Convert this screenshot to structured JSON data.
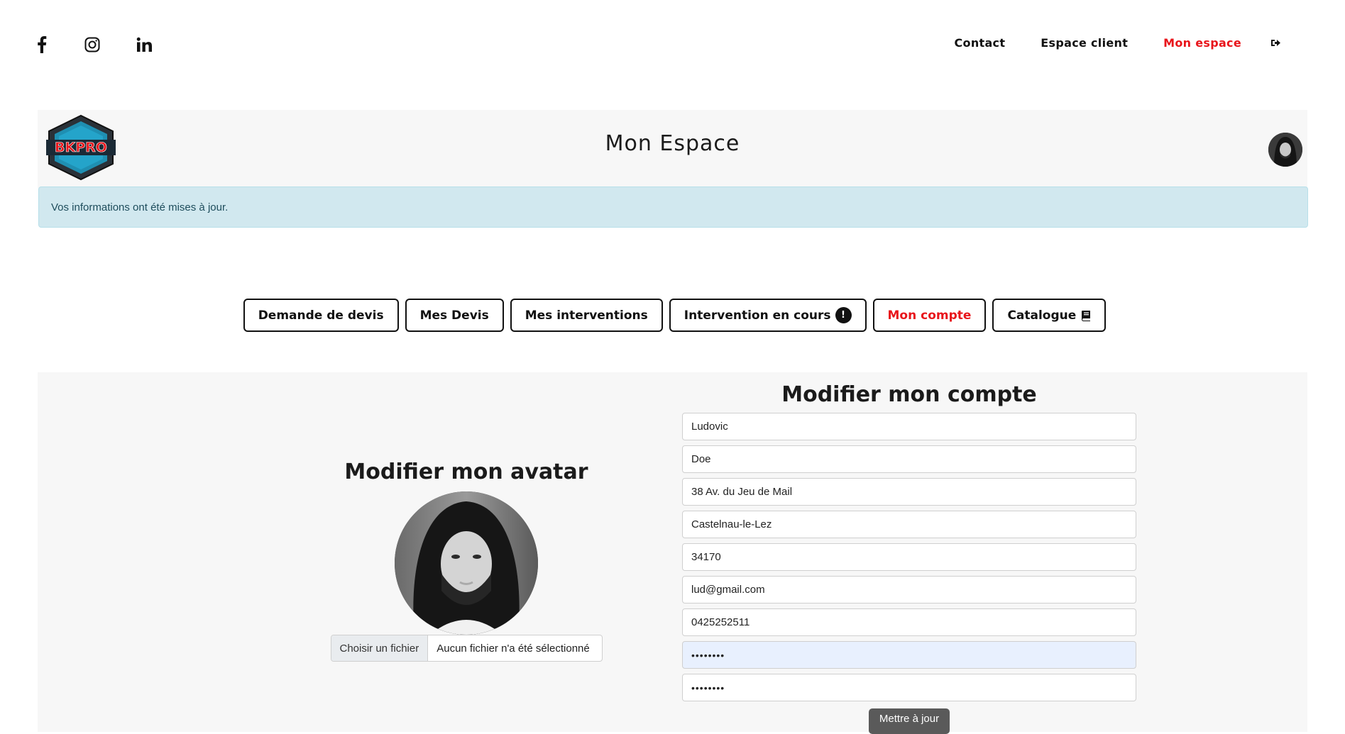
{
  "social": {
    "facebook_icon": "facebook-icon",
    "instagram_icon": "instagram-icon",
    "linkedin_icon": "linkedin-icon"
  },
  "nav": {
    "items": [
      {
        "label": "Contact",
        "active": false
      },
      {
        "label": "Espace client",
        "active": false
      },
      {
        "label": "Mon espace",
        "active": true
      }
    ],
    "logout_icon": "logout-icon",
    "active_color": "#e8151b"
  },
  "header": {
    "title": "Mon Espace",
    "logo_text": "BKPRO"
  },
  "alert": {
    "message": "Vos informations ont été mises à jour."
  },
  "tabs": [
    {
      "label": "Demande de devis"
    },
    {
      "label": "Mes Devis"
    },
    {
      "label": "Mes interventions"
    },
    {
      "label": "Intervention en cours",
      "badge": "!"
    },
    {
      "label": "Mon compte",
      "active": true
    },
    {
      "label": "Catalogue",
      "icon": "book-icon"
    }
  ],
  "avatar_section": {
    "title": "Modifier mon avatar",
    "file_button": "Choisir un fichier",
    "file_status": "Aucun fichier n'a été sélectionné"
  },
  "account_section": {
    "title": "Modifier mon compte",
    "fields": {
      "firstname": "Ludovic",
      "lastname": "Doe",
      "address": "38 Av. du Jeu de Mail",
      "city": "Castelnau-le-Lez",
      "postcode": "34170",
      "email": "lud@gmail.com",
      "phone": "0425252511",
      "password": "••••••••",
      "password_confirm": "••••••••"
    },
    "submit_label": "Mettre à jour"
  }
}
